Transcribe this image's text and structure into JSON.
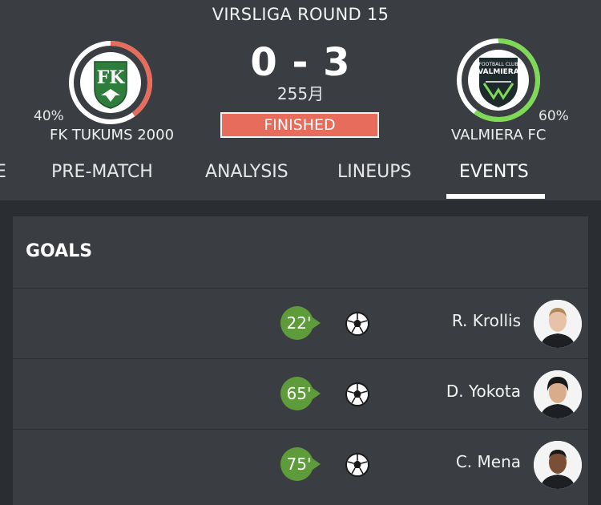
{
  "match": {
    "round_title": "VIRSLIGA ROUND 15",
    "score": "0 - 3",
    "date": "255月",
    "status": "FINISHED"
  },
  "home": {
    "name": "FK TUKUMS 2000",
    "possession_label": "40%",
    "possession": 0.4,
    "ring_color": "#e86c5c",
    "logo_text": "FK"
  },
  "away": {
    "name": "VALMIERA FC",
    "possession_label": "60%",
    "possession": 0.6,
    "ring_color": "#7ed957",
    "logo_line1": "FOOTBALL CLUB",
    "logo_line2": "VALMIERA"
  },
  "tabs": [
    {
      "label": "E"
    },
    {
      "label": "PRE-MATCH"
    },
    {
      "label": "ANALYSIS"
    },
    {
      "label": "LINEUPS"
    },
    {
      "label": "EVENTS"
    }
  ],
  "active_tab": "EVENTS",
  "goals": {
    "title": "GOALS",
    "events": [
      {
        "minute": "22'",
        "player": "R. Krollis"
      },
      {
        "minute": "65'",
        "player": "D. Yokota"
      },
      {
        "minute": "75'",
        "player": "C. Mena"
      }
    ]
  },
  "colors": {
    "minute_badge": "#5e9b3a",
    "status_bg": "#e86c5c"
  }
}
